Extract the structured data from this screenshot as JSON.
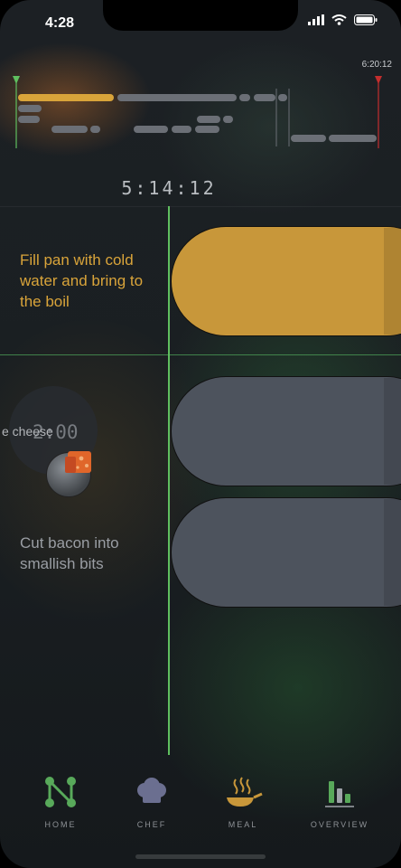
{
  "status_bar": {
    "time": "4:28"
  },
  "timeline": {
    "end_time": "6:20:12",
    "clock": "5:14:12",
    "colors": {
      "accent": "#d9a43a",
      "start_marker": "#5fbf5f",
      "end_marker": "#c42e2e",
      "bar": "#6b6f76"
    }
  },
  "tasks": [
    {
      "text": "Fill pan with cold water and bring to the boil",
      "color": "#d9a43a"
    },
    {
      "text": "",
      "color": "#9a9ea4"
    },
    {
      "text": "Cut bacon into smallish bits",
      "color": "#9a9ea4"
    }
  ],
  "drag_item": {
    "label": "e cheese",
    "timer": "2:00",
    "icon": "cheese-icon"
  },
  "nav": [
    {
      "label": "HOME",
      "icon": "home-network-icon",
      "color": "#58a95a"
    },
    {
      "label": "CHEF",
      "icon": "chef-hat-icon",
      "color": "#6b6f90"
    },
    {
      "label": "MEAL",
      "icon": "pan-icon",
      "color": "#c8973a"
    },
    {
      "label": "OVERVIEW",
      "icon": "bar-chart-icon",
      "color": "#58a95a"
    }
  ]
}
